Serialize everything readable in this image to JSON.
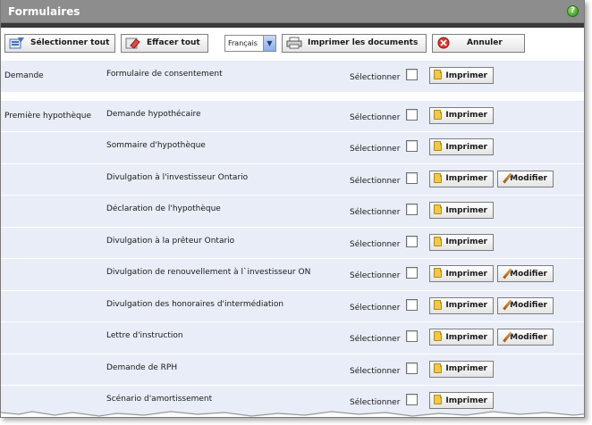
{
  "window": {
    "title": "Formulaires"
  },
  "toolbar": {
    "select_all_label": "Sélectionner tout",
    "clear_all_label": "Effacer tout",
    "language_value": "Français",
    "print_documents_label": "Imprimer les documents",
    "cancel_label": "Annuler"
  },
  "labels": {
    "select": "Sélectionner",
    "print": "Imprimer",
    "modify": "Modifier"
  },
  "sections": [
    {
      "group": "Demande",
      "forms": [
        {
          "name": "Formulaire de consentement",
          "modify": false
        }
      ]
    },
    {
      "group": "Première hypothèque",
      "forms": [
        {
          "name": "Demande hypothécaire",
          "modify": false
        },
        {
          "name": "Sommaire d'hypothèque",
          "modify": false
        },
        {
          "name": "Divulgation à l'investisseur Ontario",
          "modify": true
        },
        {
          "name": "Déclaration de l'hypothèque",
          "modify": false
        },
        {
          "name": "Divulgation à la prêteur Ontario",
          "modify": false
        },
        {
          "name": "Divulgation de renouvellement à l`investisseur ON",
          "modify": true
        },
        {
          "name": "Divulgation des honoraires d'intermédiation",
          "modify": true
        },
        {
          "name": "Lettre d'instruction",
          "modify": true
        },
        {
          "name": "Demande de RPH",
          "modify": false
        },
        {
          "name": "Scénario d'amortissement",
          "modify": false
        }
      ]
    }
  ],
  "icons": {
    "help": "help-icon",
    "select_all": "select-all-icon",
    "clear_all": "eraser-icon",
    "print": "printer-icon",
    "cancel": "cancel-icon",
    "print_row": "folder-icon",
    "modify_row": "pencil-icon"
  },
  "colors": {
    "titlebar": "#8d8d8d",
    "section_bg": "#e8edf7",
    "cancel_red": "#d93a2b",
    "help_green": "#3a9b28"
  }
}
